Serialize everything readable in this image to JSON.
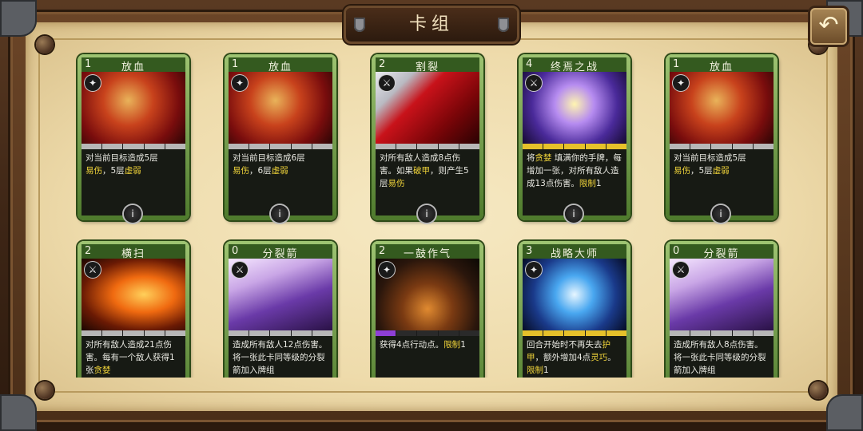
{
  "title": "卡组",
  "back_icon": "back-arrow-icon",
  "cards": [
    {
      "cost": "1",
      "name": "放血",
      "type_icon": "skill-icon",
      "art": "warrior-blood",
      "segments": [
        "#b7b7b7",
        "#b7b7b7",
        "#b7b7b7",
        "#b7b7b7",
        "#b7b7b7"
      ],
      "desc": [
        {
          "t": "对当前目标造成5层"
        },
        {
          "t": "\n"
        },
        {
          "t": "易伤",
          "hl": true
        },
        {
          "t": "，5层"
        },
        {
          "t": "虚弱",
          "hl": true
        }
      ]
    },
    {
      "cost": "1",
      "name": "放血",
      "type_icon": "skill-icon",
      "art": "warrior-blood",
      "segments": [
        "#b7b7b7",
        "#b7b7b7",
        "#b7b7b7",
        "#b7b7b7",
        "#b7b7b7"
      ],
      "desc": [
        {
          "t": "对当前目标造成6层"
        },
        {
          "t": "\n"
        },
        {
          "t": "易伤",
          "hl": true
        },
        {
          "t": "，6层"
        },
        {
          "t": "虚弱",
          "hl": true
        }
      ]
    },
    {
      "cost": "2",
      "name": "割裂",
      "type_icon": "attack-icon",
      "art": "axe-slash",
      "segments": [
        "#b7b7b7",
        "#b7b7b7",
        "#b7b7b7",
        "#b7b7b7",
        "#b7b7b7"
      ],
      "desc": [
        {
          "t": "对所有敌人造成8点伤害。如果"
        },
        {
          "t": "破甲",
          "hl": true
        },
        {
          "t": "，则产生5层"
        },
        {
          "t": "易伤",
          "hl": true
        }
      ]
    },
    {
      "cost": "4",
      "name": "终焉之战",
      "type_icon": "attack-icon",
      "art": "lightning-mage",
      "segments": [
        "#e6c12a",
        "#e6c12a",
        "#e6c12a",
        "#e6c12a",
        "#e6c12a"
      ],
      "desc": [
        {
          "t": "将"
        },
        {
          "t": "贪婪",
          "hl": true
        },
        {
          "t": " 填满你的手牌，每增加一张，对所有敌人造成13点伤害。"
        },
        {
          "t": "限制",
          "hl": true
        },
        {
          "t": "1"
        }
      ]
    },
    {
      "cost": "1",
      "name": "放血",
      "type_icon": "skill-icon",
      "art": "warrior-blood",
      "segments": [
        "#b7b7b7",
        "#b7b7b7",
        "#b7b7b7",
        "#b7b7b7",
        "#b7b7b7"
      ],
      "desc": [
        {
          "t": "对当前目标造成5层"
        },
        {
          "t": "\n"
        },
        {
          "t": "易伤",
          "hl": true
        },
        {
          "t": "，5层"
        },
        {
          "t": "虚弱",
          "hl": true
        }
      ]
    },
    {
      "cost": "2",
      "name": "横扫",
      "type_icon": "attack-icon",
      "art": "fire-sweep",
      "segments": [
        "#b7b7b7",
        "#b7b7b7",
        "#b7b7b7",
        "#b7b7b7",
        "#b7b7b7"
      ],
      "desc": [
        {
          "t": "对所有敌人造成21点伤害。每有一个敌人获得1张"
        },
        {
          "t": "贪婪",
          "hl": true
        }
      ]
    },
    {
      "cost": "0",
      "name": "分裂箭",
      "type_icon": "attack-icon",
      "art": "arrows",
      "segments": [
        "#b7b7b7",
        "#b7b7b7",
        "#b7b7b7",
        "#b7b7b7",
        "#b7b7b7"
      ],
      "desc": [
        {
          "t": "造成所有敌人12点伤害。将一张此卡同等级的分裂箭加入牌组"
        }
      ]
    },
    {
      "cost": "2",
      "name": "一鼓作气",
      "type_icon": "skill-icon",
      "art": "dark-knight",
      "segments": [
        "#8e3fd6",
        "#2a2a2a",
        "#2a2a2a",
        "#2a2a2a",
        "#2a2a2a"
      ],
      "desc": [
        {
          "t": "获得4点行动点。"
        },
        {
          "t": "限制",
          "hl": true
        },
        {
          "t": "1"
        }
      ]
    },
    {
      "cost": "3",
      "name": "战略大师",
      "type_icon": "skill-icon",
      "art": "blue-lightning",
      "segments": [
        "#e6c12a",
        "#e6c12a",
        "#e6c12a",
        "#e6c12a",
        "#e6c12a"
      ],
      "desc": [
        {
          "t": "回合开始时不再失去"
        },
        {
          "t": "护甲",
          "hl": true
        },
        {
          "t": "，额外增加4点"
        },
        {
          "t": "灵巧",
          "hl": true
        },
        {
          "t": "。"
        },
        {
          "t": "限制",
          "hl": true
        },
        {
          "t": "1"
        }
      ]
    },
    {
      "cost": "0",
      "name": "分裂箭",
      "type_icon": "attack-icon",
      "art": "arrows",
      "segments": [
        "#b7b7b7",
        "#b7b7b7",
        "#b7b7b7",
        "#b7b7b7",
        "#b7b7b7"
      ],
      "desc": [
        {
          "t": "造成所有敌人8点伤害。将一张此卡同等级的分裂箭加入牌组"
        }
      ]
    }
  ]
}
